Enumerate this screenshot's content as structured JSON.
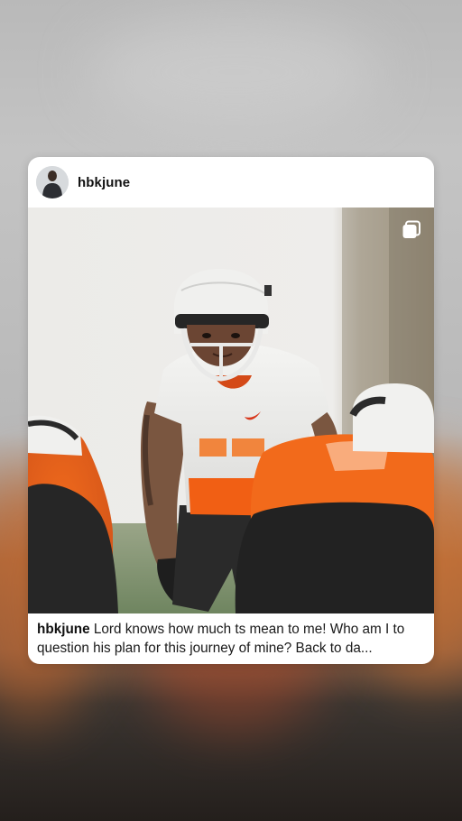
{
  "post": {
    "username": "hbkjune",
    "caption_user": "hbkjune",
    "caption_text": "Lord knows how much ts mean to me! Who am I to question his plan for this journey of mine? Back to da...",
    "media_type_icon": "multiple-photos-icon",
    "avatar_icon": "profile-avatar"
  },
  "colors": {
    "accent_orange": "#ff6a13",
    "card_bg": "#ffffff",
    "text_primary": "#111111"
  }
}
